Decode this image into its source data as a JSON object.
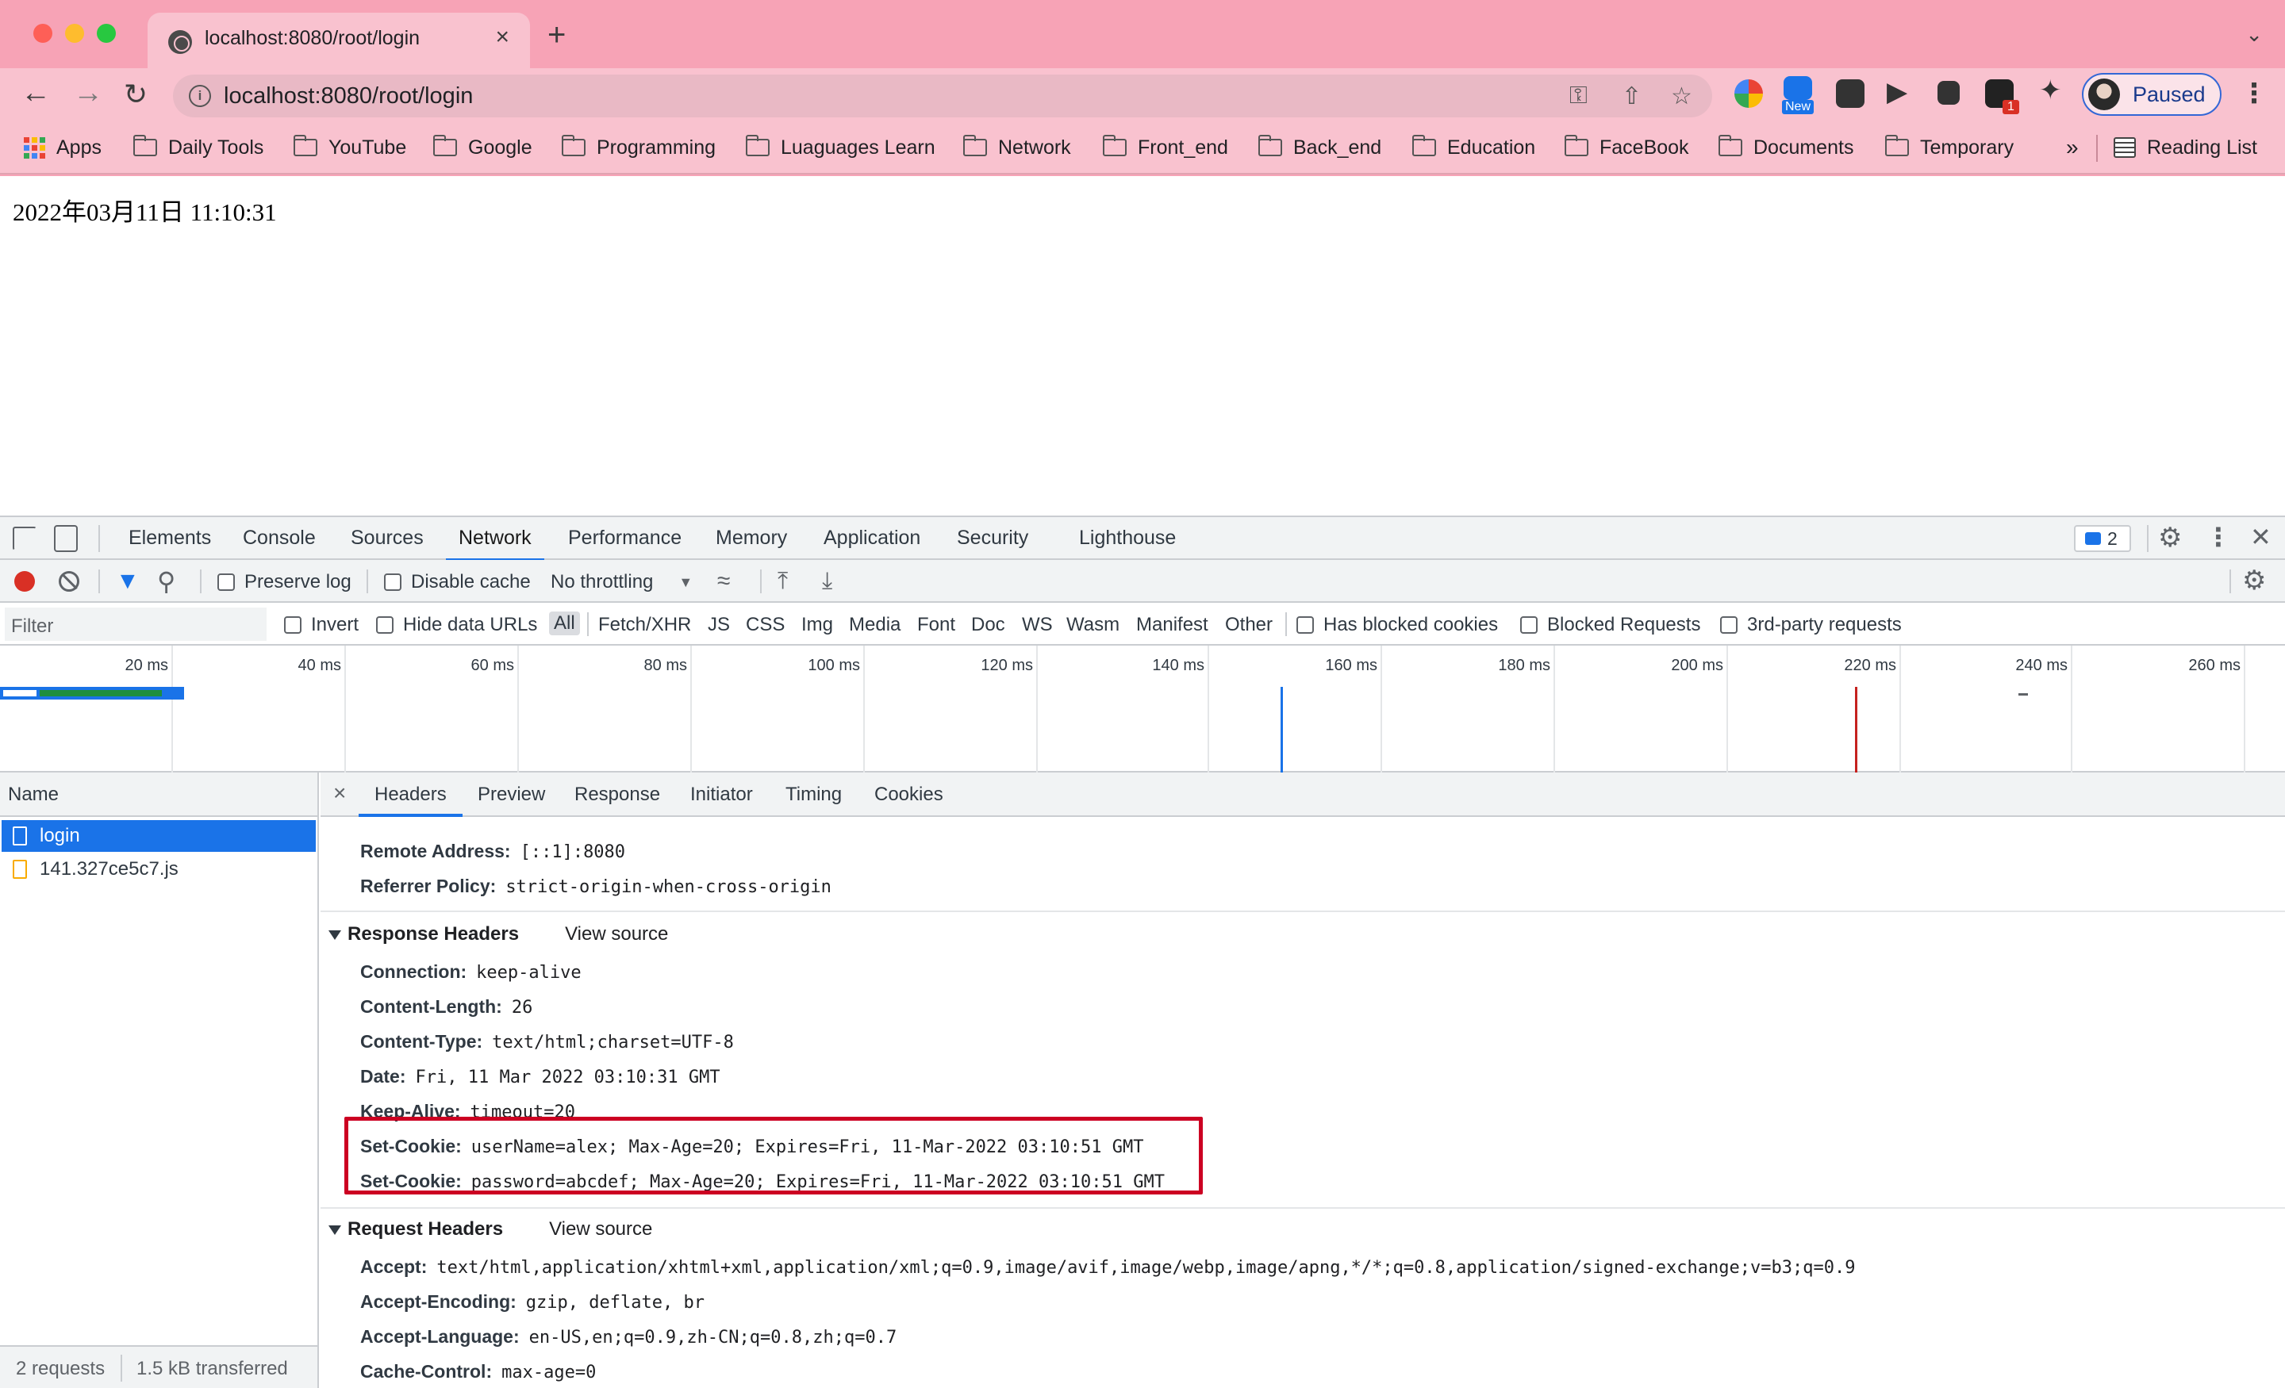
{
  "tab": {
    "title": "localhost:8080/root/login",
    "close": "×"
  },
  "newtab": "+",
  "address": {
    "url": "localhost:8080/root/login",
    "info": "i"
  },
  "profile": {
    "label": "Paused"
  },
  "ext_badges": {
    "new": "New",
    "count": "1"
  },
  "bookmarks": {
    "apps": "Apps",
    "items": [
      "Daily Tools",
      "YouTube",
      "Google",
      "Programming",
      "Luaguages Learn",
      "Network",
      "Front_end",
      "Back_end",
      "Education",
      "FaceBook",
      "Documents",
      "Temporary"
    ],
    "overflow": "»",
    "reading_list": "Reading List"
  },
  "page": {
    "datetime": "2022年03月11日 11:10:31"
  },
  "devtools": {
    "tabs": [
      "Elements",
      "Console",
      "Sources",
      "Network",
      "Performance",
      "Memory",
      "Application",
      "Security",
      "Lighthouse"
    ],
    "active_tab": "Network",
    "issues_count": "2",
    "toolbar": {
      "preserve_log": "Preserve log",
      "disable_cache": "Disable cache",
      "throttling": "No throttling"
    },
    "filter": {
      "placeholder": "Filter",
      "invert": "Invert",
      "hide_data_urls": "Hide data URLs",
      "types": [
        "All",
        "Fetch/XHR",
        "JS",
        "CSS",
        "Img",
        "Media",
        "Font",
        "Doc",
        "WS",
        "Wasm",
        "Manifest",
        "Other"
      ],
      "has_blocked_cookies": "Has blocked cookies",
      "blocked_requests": "Blocked Requests",
      "third_party": "3rd-party requests"
    },
    "timeline": [
      "20 ms",
      "40 ms",
      "60 ms",
      "80 ms",
      "100 ms",
      "120 ms",
      "140 ms",
      "160 ms",
      "180 ms",
      "200 ms",
      "220 ms",
      "240 ms",
      "260 ms"
    ],
    "requests_header": "Name",
    "requests": [
      {
        "name": "login",
        "selected": true
      },
      {
        "name": "141.327ce5c7.js",
        "selected": false
      }
    ],
    "footer": {
      "requests": "2 requests",
      "transferred": "1.5 kB transferred"
    },
    "detail_tabs": [
      "Headers",
      "Preview",
      "Response",
      "Initiator",
      "Timing",
      "Cookies"
    ],
    "general": [
      {
        "k": "Remote Address:",
        "v": "[::1]:8080"
      },
      {
        "k": "Referrer Policy:",
        "v": "strict-origin-when-cross-origin"
      }
    ],
    "response_headers": {
      "title": "Response Headers",
      "view_source": "View source",
      "rows": [
        {
          "k": "Connection:",
          "v": "keep-alive"
        },
        {
          "k": "Content-Length:",
          "v": "26"
        },
        {
          "k": "Content-Type:",
          "v": "text/html;charset=UTF-8"
        },
        {
          "k": "Date:",
          "v": "Fri, 11 Mar 2022 03:10:31 GMT"
        },
        {
          "k": "Keep-Alive:",
          "v": "timeout=20"
        },
        {
          "k": "Set-Cookie:",
          "v": "userName=alex; Max-Age=20; Expires=Fri, 11-Mar-2022 03:10:51 GMT"
        },
        {
          "k": "Set-Cookie:",
          "v": "password=abcdef; Max-Age=20; Expires=Fri, 11-Mar-2022 03:10:51 GMT"
        }
      ]
    },
    "request_headers": {
      "title": "Request Headers",
      "view_source": "View source",
      "rows": [
        {
          "k": "Accept:",
          "v": "text/html,application/xhtml+xml,application/xml;q=0.9,image/avif,image/webp,image/apng,*/*;q=0.8,application/signed-exchange;v=b3;q=0.9"
        },
        {
          "k": "Accept-Encoding:",
          "v": "gzip, deflate, br"
        },
        {
          "k": "Accept-Language:",
          "v": "en-US,en;q=0.9,zh-CN;q=0.8,zh;q=0.7"
        },
        {
          "k": "Cache-Control:",
          "v": "max-age=0"
        }
      ]
    }
  },
  "colors": {
    "chrome_frame": "#f7a3b6",
    "active_tab": "#f9c2cf",
    "accent_blue": "#1a73e8",
    "record_red": "#d93025",
    "highlight_red": "#cc0022"
  }
}
